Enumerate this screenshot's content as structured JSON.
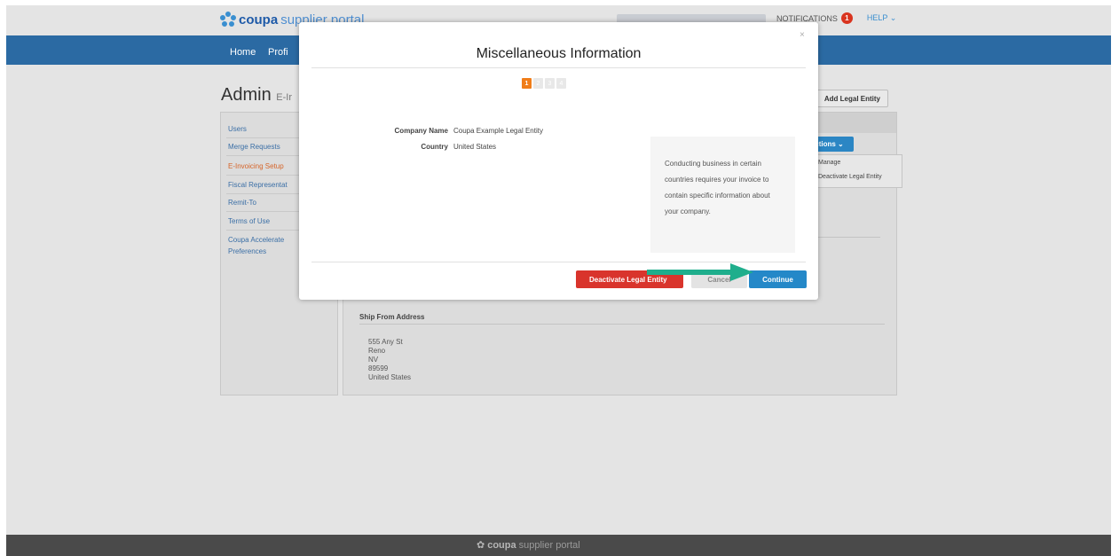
{
  "header": {
    "logo_strong": "coupa",
    "logo_light": "supplier portal",
    "notifications_label": "NOTIFICATIONS",
    "notifications_count": "1",
    "help_label": "HELP ⌄"
  },
  "nav": {
    "items": [
      "Home",
      "Profi"
    ]
  },
  "page": {
    "title": "Admin",
    "title_suffix": "E-Ir",
    "add_button": "Add Legal Entity",
    "actions_button": "ctions ⌄",
    "actions_menu": [
      "Manage",
      "Deactivate Legal Entity"
    ]
  },
  "sidebar": {
    "items": [
      {
        "label": "Users"
      },
      {
        "label": "Merge Requests"
      },
      {
        "label": "E-Invoicing Setup"
      },
      {
        "label": "Fiscal Representat"
      },
      {
        "label": "Remit-To"
      },
      {
        "label": "Terms of Use"
      },
      {
        "label": "Coupa Accelerate"
      },
      {
        "label": "Preferences"
      }
    ]
  },
  "ship_from": {
    "title": "Ship From Address",
    "lines": [
      "555 Any St",
      "Reno",
      "NV",
      "89599",
      "United States"
    ]
  },
  "footer": {
    "logo_strong": "coupa",
    "logo_light": "supplier portal"
  },
  "modal": {
    "title": "Miscellaneous Information",
    "close": "×",
    "steps": [
      "1",
      "2",
      "3",
      "4"
    ],
    "company_name_label": "Company Name",
    "company_name_value": "Coupa Example Legal Entity",
    "country_label": "Country",
    "country_value": "United States",
    "info_text": "Conducting business in certain countries requires your invoice to contain specific information about your company.",
    "deactivate_button": "Deactivate Legal Entity",
    "cancel_button": "Cancel",
    "continue_button": "Continue"
  },
  "colors": {
    "nav_blue": "#2b6aa3",
    "accent_orange": "#f07d19",
    "danger_red": "#d9342c",
    "primary_blue": "#2488c8",
    "arrow_teal": "#1fae8c"
  }
}
